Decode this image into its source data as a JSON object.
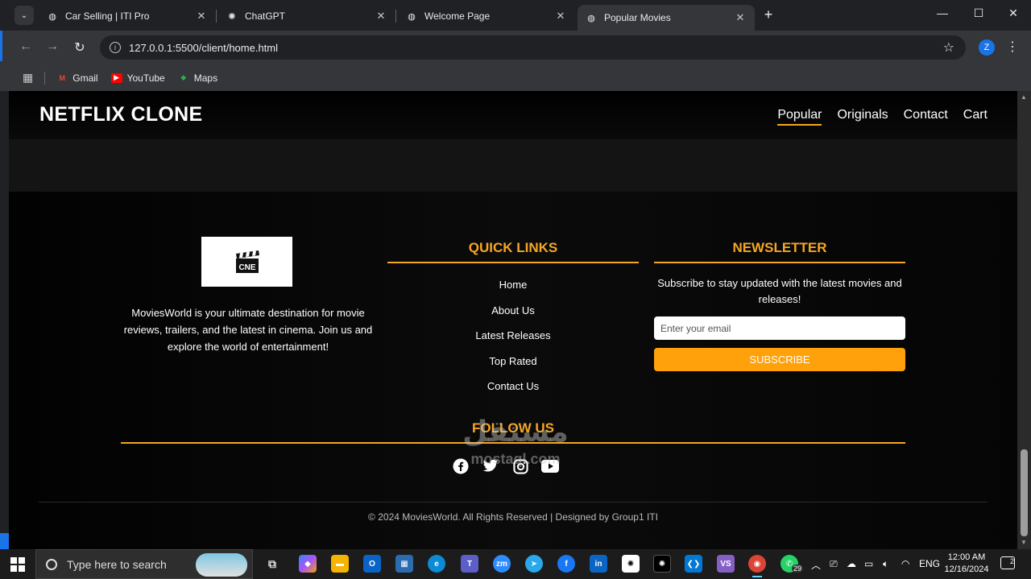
{
  "browser": {
    "tabs": [
      {
        "title": "Car Selling | ITI Pro",
        "favicon": "globe-icon",
        "active": false
      },
      {
        "title": "ChatGPT",
        "favicon": "chatgpt-icon",
        "active": false
      },
      {
        "title": "Welcome Page",
        "favicon": "globe-icon",
        "active": false
      },
      {
        "title": "Popular Movies",
        "favicon": "globe-icon",
        "active": true
      }
    ],
    "url": "127.0.0.1:5500/client/home.html",
    "profile_initial": "Z",
    "bookmarks": [
      {
        "label": "Gmail",
        "icon": "gmail-icon",
        "color": "#ea4335"
      },
      {
        "label": "YouTube",
        "icon": "youtube-icon",
        "color": "#ff0000"
      },
      {
        "label": "Maps",
        "icon": "maps-icon",
        "color": "#34a853"
      }
    ]
  },
  "site": {
    "brand": "NETFLIX CLONE",
    "nav": [
      {
        "label": "Popular",
        "active": true
      },
      {
        "label": "Originals",
        "active": false
      },
      {
        "label": "Contact",
        "active": false
      },
      {
        "label": "Cart",
        "active": false
      }
    ],
    "footer": {
      "logo_text": "CNE",
      "about": "MoviesWorld is your ultimate destination for movie reviews, trailers, and the latest in cinema. Join us and explore the world of entertainment!",
      "quick_links_title": "QUICK LINKS",
      "quick_links": [
        "Home",
        "About Us",
        "Latest Releases",
        "Top Rated",
        "Contact Us"
      ],
      "newsletter_title": "NEWSLETTER",
      "newsletter_text": "Subscribe to stay updated with the latest movies and releases!",
      "email_placeholder": "Enter your email",
      "subscribe_label": "SUBSCRIBE",
      "follow_title": "FOLLOW US",
      "socials": [
        "facebook-icon",
        "twitter-icon",
        "instagram-icon",
        "youtube-icon"
      ],
      "copyright": "© 2024 MoviesWorld. All Rights Reserved | Designed by Group1 ITI"
    },
    "accent_color": "#f5a623"
  },
  "watermark": {
    "arabic": "مستقل",
    "latin": "mostaql.com"
  },
  "taskbar": {
    "search_placeholder": "Type here to search",
    "whatsapp_badge": "29",
    "language": "ENG",
    "time": "12:00 AM",
    "date": "12/16/2024",
    "notification_count": "2"
  }
}
